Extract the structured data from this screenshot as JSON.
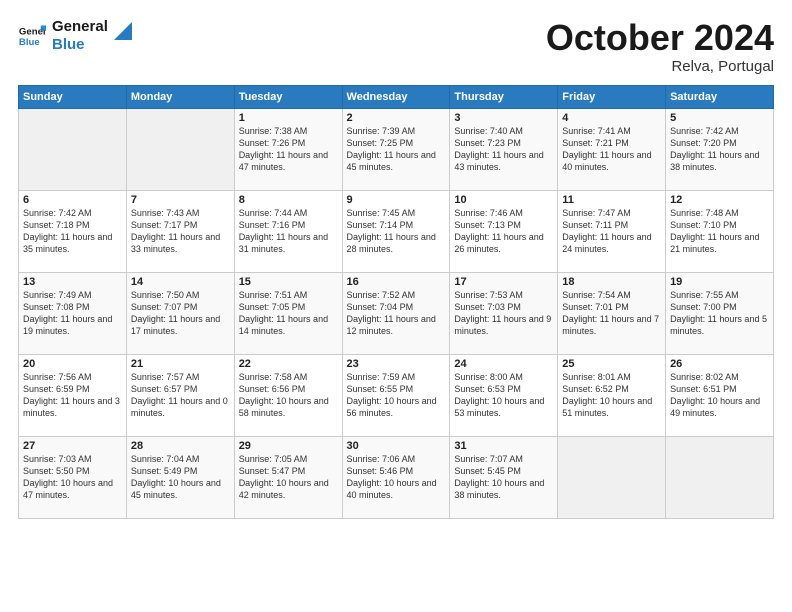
{
  "logo": {
    "line1": "General",
    "line2": "Blue"
  },
  "header": {
    "month": "October 2024",
    "location": "Relva, Portugal"
  },
  "weekdays": [
    "Sunday",
    "Monday",
    "Tuesday",
    "Wednesday",
    "Thursday",
    "Friday",
    "Saturday"
  ],
  "weeks": [
    [
      {
        "day": "",
        "empty": true
      },
      {
        "day": "",
        "empty": true
      },
      {
        "day": "1",
        "sunrise": "Sunrise: 7:38 AM",
        "sunset": "Sunset: 7:26 PM",
        "daylight": "Daylight: 11 hours and 47 minutes."
      },
      {
        "day": "2",
        "sunrise": "Sunrise: 7:39 AM",
        "sunset": "Sunset: 7:25 PM",
        "daylight": "Daylight: 11 hours and 45 minutes."
      },
      {
        "day": "3",
        "sunrise": "Sunrise: 7:40 AM",
        "sunset": "Sunset: 7:23 PM",
        "daylight": "Daylight: 11 hours and 43 minutes."
      },
      {
        "day": "4",
        "sunrise": "Sunrise: 7:41 AM",
        "sunset": "Sunset: 7:21 PM",
        "daylight": "Daylight: 11 hours and 40 minutes."
      },
      {
        "day": "5",
        "sunrise": "Sunrise: 7:42 AM",
        "sunset": "Sunset: 7:20 PM",
        "daylight": "Daylight: 11 hours and 38 minutes."
      }
    ],
    [
      {
        "day": "6",
        "sunrise": "Sunrise: 7:42 AM",
        "sunset": "Sunset: 7:18 PM",
        "daylight": "Daylight: 11 hours and 35 minutes."
      },
      {
        "day": "7",
        "sunrise": "Sunrise: 7:43 AM",
        "sunset": "Sunset: 7:17 PM",
        "daylight": "Daylight: 11 hours and 33 minutes."
      },
      {
        "day": "8",
        "sunrise": "Sunrise: 7:44 AM",
        "sunset": "Sunset: 7:16 PM",
        "daylight": "Daylight: 11 hours and 31 minutes."
      },
      {
        "day": "9",
        "sunrise": "Sunrise: 7:45 AM",
        "sunset": "Sunset: 7:14 PM",
        "daylight": "Daylight: 11 hours and 28 minutes."
      },
      {
        "day": "10",
        "sunrise": "Sunrise: 7:46 AM",
        "sunset": "Sunset: 7:13 PM",
        "daylight": "Daylight: 11 hours and 26 minutes."
      },
      {
        "day": "11",
        "sunrise": "Sunrise: 7:47 AM",
        "sunset": "Sunset: 7:11 PM",
        "daylight": "Daylight: 11 hours and 24 minutes."
      },
      {
        "day": "12",
        "sunrise": "Sunrise: 7:48 AM",
        "sunset": "Sunset: 7:10 PM",
        "daylight": "Daylight: 11 hours and 21 minutes."
      }
    ],
    [
      {
        "day": "13",
        "sunrise": "Sunrise: 7:49 AM",
        "sunset": "Sunset: 7:08 PM",
        "daylight": "Daylight: 11 hours and 19 minutes."
      },
      {
        "day": "14",
        "sunrise": "Sunrise: 7:50 AM",
        "sunset": "Sunset: 7:07 PM",
        "daylight": "Daylight: 11 hours and 17 minutes."
      },
      {
        "day": "15",
        "sunrise": "Sunrise: 7:51 AM",
        "sunset": "Sunset: 7:05 PM",
        "daylight": "Daylight: 11 hours and 14 minutes."
      },
      {
        "day": "16",
        "sunrise": "Sunrise: 7:52 AM",
        "sunset": "Sunset: 7:04 PM",
        "daylight": "Daylight: 11 hours and 12 minutes."
      },
      {
        "day": "17",
        "sunrise": "Sunrise: 7:53 AM",
        "sunset": "Sunset: 7:03 PM",
        "daylight": "Daylight: 11 hours and 9 minutes."
      },
      {
        "day": "18",
        "sunrise": "Sunrise: 7:54 AM",
        "sunset": "Sunset: 7:01 PM",
        "daylight": "Daylight: 11 hours and 7 minutes."
      },
      {
        "day": "19",
        "sunrise": "Sunrise: 7:55 AM",
        "sunset": "Sunset: 7:00 PM",
        "daylight": "Daylight: 11 hours and 5 minutes."
      }
    ],
    [
      {
        "day": "20",
        "sunrise": "Sunrise: 7:56 AM",
        "sunset": "Sunset: 6:59 PM",
        "daylight": "Daylight: 11 hours and 3 minutes."
      },
      {
        "day": "21",
        "sunrise": "Sunrise: 7:57 AM",
        "sunset": "Sunset: 6:57 PM",
        "daylight": "Daylight: 11 hours and 0 minutes."
      },
      {
        "day": "22",
        "sunrise": "Sunrise: 7:58 AM",
        "sunset": "Sunset: 6:56 PM",
        "daylight": "Daylight: 10 hours and 58 minutes."
      },
      {
        "day": "23",
        "sunrise": "Sunrise: 7:59 AM",
        "sunset": "Sunset: 6:55 PM",
        "daylight": "Daylight: 10 hours and 56 minutes."
      },
      {
        "day": "24",
        "sunrise": "Sunrise: 8:00 AM",
        "sunset": "Sunset: 6:53 PM",
        "daylight": "Daylight: 10 hours and 53 minutes."
      },
      {
        "day": "25",
        "sunrise": "Sunrise: 8:01 AM",
        "sunset": "Sunset: 6:52 PM",
        "daylight": "Daylight: 10 hours and 51 minutes."
      },
      {
        "day": "26",
        "sunrise": "Sunrise: 8:02 AM",
        "sunset": "Sunset: 6:51 PM",
        "daylight": "Daylight: 10 hours and 49 minutes."
      }
    ],
    [
      {
        "day": "27",
        "sunrise": "Sunrise: 7:03 AM",
        "sunset": "Sunset: 5:50 PM",
        "daylight": "Daylight: 10 hours and 47 minutes."
      },
      {
        "day": "28",
        "sunrise": "Sunrise: 7:04 AM",
        "sunset": "Sunset: 5:49 PM",
        "daylight": "Daylight: 10 hours and 45 minutes."
      },
      {
        "day": "29",
        "sunrise": "Sunrise: 7:05 AM",
        "sunset": "Sunset: 5:47 PM",
        "daylight": "Daylight: 10 hours and 42 minutes."
      },
      {
        "day": "30",
        "sunrise": "Sunrise: 7:06 AM",
        "sunset": "Sunset: 5:46 PM",
        "daylight": "Daylight: 10 hours and 40 minutes."
      },
      {
        "day": "31",
        "sunrise": "Sunrise: 7:07 AM",
        "sunset": "Sunset: 5:45 PM",
        "daylight": "Daylight: 10 hours and 38 minutes."
      },
      {
        "day": "",
        "empty": true
      },
      {
        "day": "",
        "empty": true
      }
    ]
  ]
}
